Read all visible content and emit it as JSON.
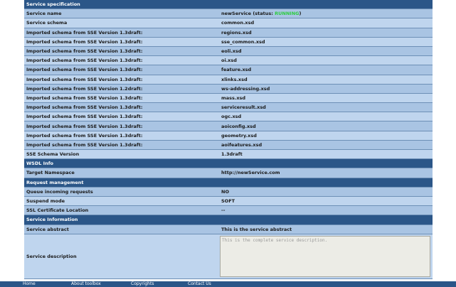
{
  "spec": {
    "header": "Service specification",
    "service_name_label": "Service name",
    "service_name_prefix": "newService (status: ",
    "service_status": "RUNNING",
    "service_name_suffix": ")",
    "rows": [
      {
        "label": "Service schema",
        "value": "common.xsd"
      },
      {
        "label": "Imported schema from SSE Version 1.3draft:",
        "value": "regions.xsd"
      },
      {
        "label": "Imported schema from SSE Version 1.3draft:",
        "value": "sse_common.xsd"
      },
      {
        "label": "Imported schema from SSE Version 1.3draft:",
        "value": "eoli.xsd"
      },
      {
        "label": "Imported schema from SSE Version 1.3draft:",
        "value": "oi.xsd"
      },
      {
        "label": "Imported schema from SSE Version 1.3draft:",
        "value": "feature.xsd"
      },
      {
        "label": "Imported schema from SSE Version 1.3draft:",
        "value": "xlinks.xsd"
      },
      {
        "label": "Imported schema from SSE Version 1.2draft:",
        "value": "ws-addressing.xsd"
      },
      {
        "label": "Imported schema from SSE Version 1.3draft:",
        "value": "mass.xsd"
      },
      {
        "label": "Imported schema from SSE Version 1.3draft:",
        "value": "serviceresult.xsd"
      },
      {
        "label": "Imported schema from SSE Version 1.3draft:",
        "value": "ogc.xsd"
      },
      {
        "label": "Imported schema from SSE Version 1.3draft:",
        "value": "aoiconfig.xsd"
      },
      {
        "label": "Imported schema from SSE Version 1.3draft:",
        "value": "geometry.xsd"
      },
      {
        "label": "Imported schema from SSE Version 1.3draft:",
        "value": "aoifeatures.xsd"
      },
      {
        "label": "SSE Schema Version",
        "value": "1.3draft"
      }
    ]
  },
  "wsdl": {
    "header": "WSDL Info",
    "target_label": "Target Namespace",
    "target_value": "http://newService.com"
  },
  "request": {
    "header": "Request management",
    "rows": [
      {
        "label": "Queue incoming requests",
        "value": "NO"
      },
      {
        "label": "Suspend mode",
        "value": "SOFT"
      },
      {
        "label": "SSL Certificate Location",
        "value": "--"
      }
    ]
  },
  "info": {
    "header": "Service Information",
    "abstract_label": "Service abstract",
    "abstract_value": "This is the service abstract",
    "description_label": "Service description",
    "description_value": "This is the complete service description."
  },
  "footer": {
    "links": [
      "Home",
      "About toolbox",
      "Copyrights",
      "Contact Us"
    ]
  },
  "colors": {
    "header_bg": "#2b5688",
    "row_odd": "#a9c4e3",
    "row_even": "#bfd5ee",
    "status": "#2ecc40"
  }
}
